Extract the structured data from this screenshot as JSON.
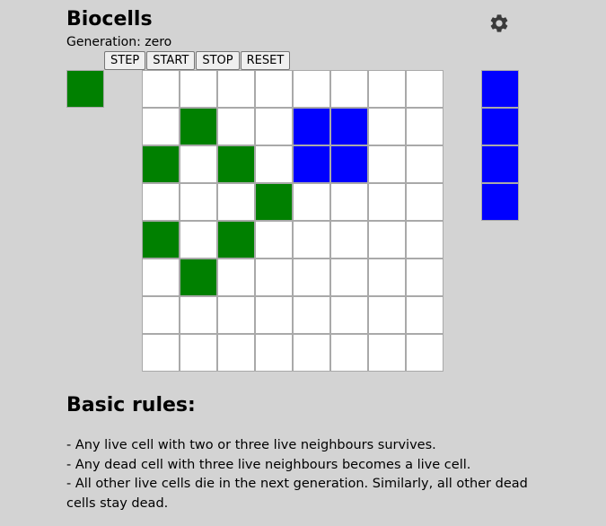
{
  "app": {
    "title": "Biocells",
    "generation_label": "Generation: zero"
  },
  "icons": {
    "settings": "gear-icon"
  },
  "controls": {
    "step_label": "STEP",
    "start_label": "START",
    "stop_label": "STOP",
    "reset_label": "RESET"
  },
  "colors": {
    "background": "#d3d3d3",
    "empty": "#ffffff",
    "green": "#008000",
    "blue": "#0000ff"
  },
  "selected_species": "green",
  "board": {
    "rows": [
      [
        "empty",
        "empty",
        "empty",
        "empty",
        "empty",
        "empty",
        "empty",
        "empty"
      ],
      [
        "empty",
        "green",
        "empty",
        "empty",
        "blue",
        "blue",
        "empty",
        "empty"
      ],
      [
        "green",
        "empty",
        "green",
        "empty",
        "blue",
        "blue",
        "empty",
        "empty"
      ],
      [
        "empty",
        "empty",
        "empty",
        "green",
        "empty",
        "empty",
        "empty",
        "empty"
      ],
      [
        "green",
        "empty",
        "green",
        "empty",
        "empty",
        "empty",
        "empty",
        "empty"
      ],
      [
        "empty",
        "green",
        "empty",
        "empty",
        "empty",
        "empty",
        "empty",
        "empty"
      ],
      [
        "empty",
        "empty",
        "empty",
        "empty",
        "empty",
        "empty",
        "empty",
        "empty"
      ],
      [
        "empty",
        "empty",
        "empty",
        "empty",
        "empty",
        "empty",
        "empty",
        "empty"
      ]
    ]
  },
  "palette": [
    "blue",
    "blue",
    "blue",
    "blue"
  ],
  "rules": {
    "heading": "Basic rules:",
    "lines": [
      "- Any live cell with two or three live neighbours survives.",
      "- Any dead cell with three live neighbours becomes a live cell.",
      "- All other live cells die in the next generation. Similarly, all other dead cells stay dead."
    ]
  }
}
